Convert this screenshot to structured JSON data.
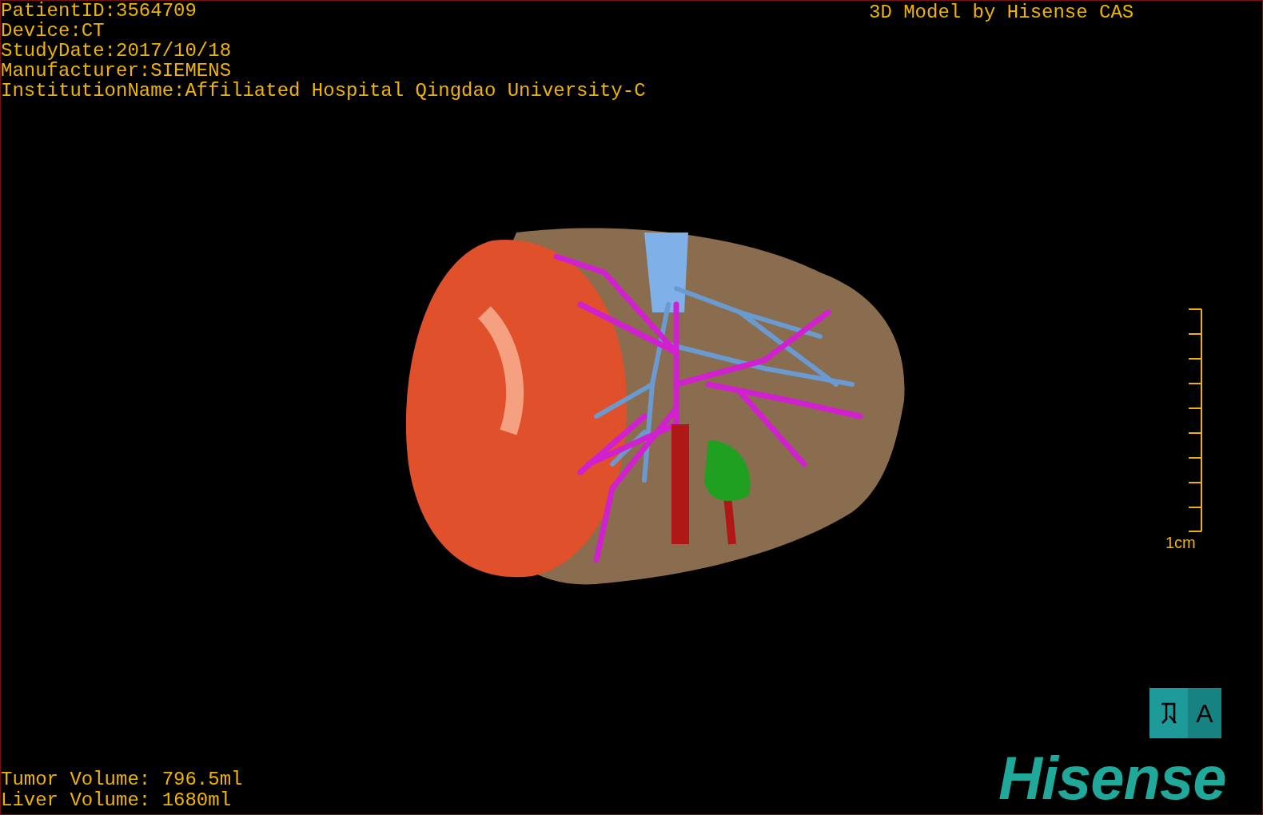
{
  "info_lines": [
    "PatientID:3564709",
    "Device:CT",
    "StudyDate:2017/10/18",
    "Manufacturer:SIEMENS",
    "InstitutionName:Affiliated Hospital Qingdao University-C"
  ],
  "credit": "3D Model by Hisense CAS",
  "scale_bar": {
    "label": "1cm"
  },
  "orientation_cube": {
    "front_label": "A"
  },
  "volumes": [
    "Tumor Volume: 796.5ml",
    "Liver Volume: 1680ml"
  ],
  "logo": "Hisense"
}
